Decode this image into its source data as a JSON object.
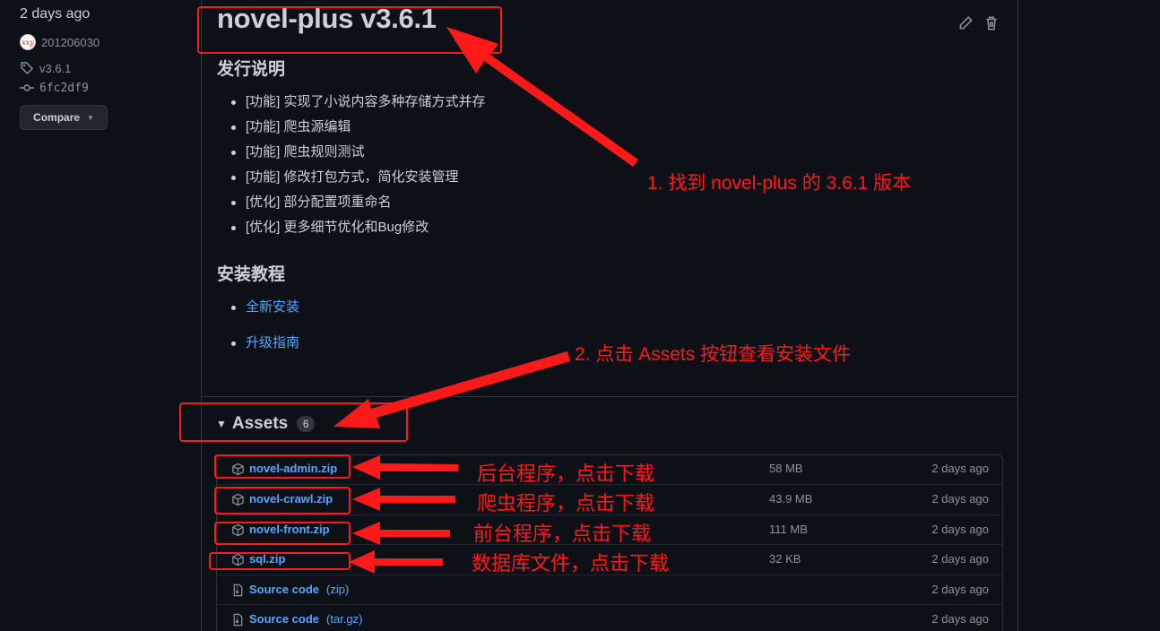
{
  "meta": {
    "date": "2 days ago",
    "author": "201206030",
    "avatar_text": "xxy",
    "tag": "v3.6.1",
    "commit": "6fc2df9",
    "compare_label": "Compare"
  },
  "release": {
    "title": "novel-plus v3.6.1",
    "notes_heading": "发行说明",
    "notes": [
      "[功能] 实现了小说内容多种存储方式并存",
      "[功能] 爬虫源编辑",
      "[功能] 爬虫规则测试",
      "[功能] 修改打包方式，简化安装管理",
      "[优化] 部分配置项重命名",
      "[优化] 更多细节优化和Bug修改"
    ],
    "install_heading": "安装教程",
    "install_links": [
      "全新安装",
      "升级指南"
    ]
  },
  "assets": {
    "label": "Assets",
    "count": "6",
    "items": [
      {
        "name": "novel-admin.zip",
        "ext": "",
        "size": "58 MB",
        "date": "2 days ago",
        "icon": "package-icon"
      },
      {
        "name": "novel-crawl.zip",
        "ext": "",
        "size": "43.9 MB",
        "date": "2 days ago",
        "icon": "package-icon"
      },
      {
        "name": "novel-front.zip",
        "ext": "",
        "size": "111 MB",
        "date": "2 days ago",
        "icon": "package-icon"
      },
      {
        "name": "sql.zip",
        "ext": "",
        "size": "32 KB",
        "date": "2 days ago",
        "icon": "package-icon"
      },
      {
        "name": "Source code",
        "ext": "(zip)",
        "size": "",
        "date": "2 days ago",
        "icon": "file-zip-icon"
      },
      {
        "name": "Source code",
        "ext": "(tar.gz)",
        "size": "",
        "date": "2 days ago",
        "icon": "file-zip-icon"
      }
    ]
  },
  "annotations": {
    "step1": "1. 找到 novel-plus 的 3.6.1 版本",
    "step2": "2. 点击 Assets 按钮查看安装文件",
    "admin_note": "后台程序，点击下载",
    "crawl_note": "爬虫程序，点击下载",
    "front_note": "前台程序，点击下载",
    "sql_note": "数据库文件，点击下载",
    "color": "#ff1a1a"
  },
  "colors": {
    "background": "#0d1117",
    "text": "#c9d1d9",
    "muted": "#8b949e",
    "link": "#58a6ff",
    "border": "#30363d"
  }
}
